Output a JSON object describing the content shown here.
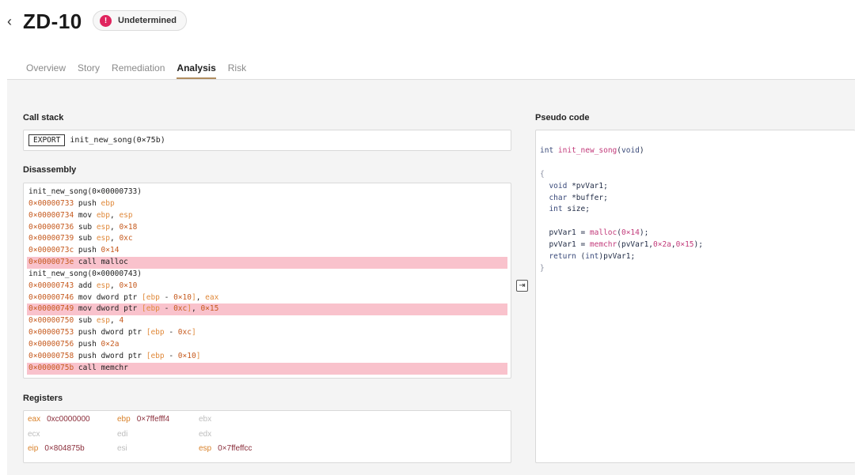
{
  "header": {
    "back_icon": "chevron-left-icon",
    "title": "ZD-10",
    "status_icon": "!",
    "status_label": "Undetermined",
    "status_color": "#e0245e"
  },
  "tabs": [
    {
      "label": "Overview",
      "active": false
    },
    {
      "label": "Story",
      "active": false
    },
    {
      "label": "Remediation",
      "active": false
    },
    {
      "label": "Analysis",
      "active": true
    },
    {
      "label": "Risk",
      "active": false
    }
  ],
  "call_stack": {
    "label": "Call stack",
    "tag": "EXPORT",
    "value": "init_new_song(0×75b)"
  },
  "disassembly": {
    "label": "Disassembly",
    "lines": [
      {
        "text": "init_new_song(0×00000733)",
        "highlight": false
      },
      {
        "text": "0×00000733 push ebp",
        "highlight": false
      },
      {
        "text": "0×00000734 mov ebp, esp",
        "highlight": false
      },
      {
        "text": "0×00000736 sub esp, 0×18",
        "highlight": false
      },
      {
        "text": "0×00000739 sub esp, 0xc",
        "highlight": false
      },
      {
        "text": "0×0000073c push 0×14",
        "highlight": false
      },
      {
        "text": "0×0000073e call malloc",
        "highlight": true
      },
      {
        "text": "init_new_song(0×00000743)",
        "highlight": false
      },
      {
        "text": "0×00000743 add esp, 0×10",
        "highlight": false
      },
      {
        "text": "0×00000746 mov dword ptr [ebp - 0×10], eax",
        "highlight": false
      },
      {
        "text": "0×00000749 mov dword ptr [ebp - 0xc], 0×15",
        "highlight": true
      },
      {
        "text": "0×00000750 sub esp, 4",
        "highlight": false
      },
      {
        "text": "0×00000753 push dword ptr [ebp - 0xc]",
        "highlight": false
      },
      {
        "text": "0×00000756 push 0×2a",
        "highlight": false
      },
      {
        "text": "0×00000758 push dword ptr [ebp - 0×10]",
        "highlight": false
      },
      {
        "text": "0×0000075b call memchr",
        "highlight": true
      }
    ]
  },
  "registers": {
    "label": "Registers",
    "items": [
      {
        "name": "eax",
        "value": "0xc0000000"
      },
      {
        "name": "ebp",
        "value": "0×7ffefff4"
      },
      {
        "name": "ebx",
        "value": ""
      },
      {
        "name": "ecx",
        "value": ""
      },
      {
        "name": "edi",
        "value": ""
      },
      {
        "name": "edx",
        "value": ""
      },
      {
        "name": "eip",
        "value": "0×804875b"
      },
      {
        "name": "esi",
        "value": ""
      },
      {
        "name": "esp",
        "value": "0×7ffeffcc"
      }
    ]
  },
  "swap_icon": "arrow-into-box-icon",
  "pseudo_code": {
    "label": "Pseudo code",
    "lines": [
      "int init_new_song(void)",
      "",
      "{",
      "  void *pvVar1;",
      "  char *buffer;",
      "  int size;",
      "",
      "  pvVar1 = malloc(0×14);",
      "  pvVar1 = memchr(pvVar1,0×2a,0×15);",
      "  return (int)pvVar1;",
      "}"
    ]
  },
  "colors": {
    "highlight": "#f9c2cc",
    "accent": "#b08d5f",
    "address": "#c65a1e",
    "register": "#e08a3c"
  }
}
